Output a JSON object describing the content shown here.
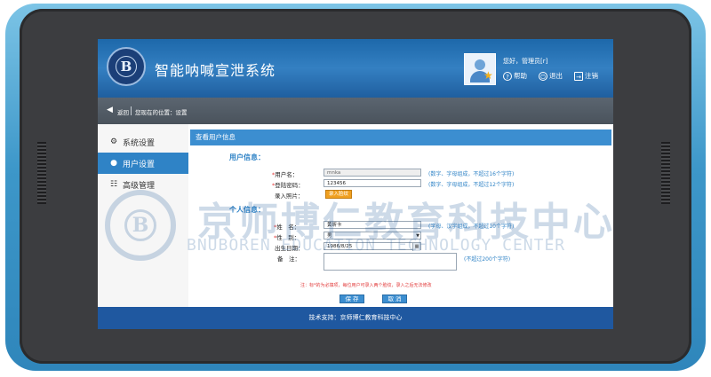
{
  "app": {
    "title": "智能呐喊宣泄系统"
  },
  "header": {
    "greeting": "您好，管理员[r]",
    "help_label": "帮助",
    "exit_label": "退出",
    "logout_label": "注销",
    "logo_text": "B"
  },
  "breadcrumb": {
    "back_label": "返回",
    "location": "您现在的位置：设置"
  },
  "sidebar": {
    "items": [
      {
        "label": "系统设置",
        "icon": "gear-icon",
        "active": false
      },
      {
        "label": "用户设置",
        "icon": "user-icon",
        "active": true
      },
      {
        "label": "高级管理",
        "icon": "sliders-icon",
        "active": false
      }
    ]
  },
  "panel": {
    "title": "查看用户信息"
  },
  "user_info": {
    "section_title": "用户信息：",
    "username_label": "用户名：",
    "username_value": "mnka",
    "username_hint": "(数字、字母组成，不超过16个字符)",
    "password_label": "登陆密码：",
    "password_value": "123456",
    "password_hint": "(数字、字母组成，不超过12个字符)",
    "avatar_label": "录入照片：",
    "avatar_button": "录入脸纹"
  },
  "personal_info": {
    "section_title": "个人信息：",
    "name_label": "姓　名：",
    "name_value": "黄昕卡",
    "name_hint": "(字母、汉字组成，不超过10个字符)",
    "gender_label": "性　别：",
    "gender_value": "男",
    "birth_label": "出生日期：",
    "birth_value": "1986/8/25",
    "note_label": "备　注：",
    "note_value": "",
    "note_hint": "(不超过200个字符)"
  },
  "notice": "注：标*的为必填项，每位用户可录入两个脸纹，录入之后无法修改",
  "actions": {
    "save": "保 存",
    "cancel": "取 消"
  },
  "footer": {
    "text": "技术支持：京师博仁教育科技中心"
  },
  "watermark": {
    "cn": "京师博仁教育科技中心",
    "en": "BNUBOREN EDUCATION TECHNOLOGY CENTER"
  },
  "colors": {
    "header": "#2f76b8",
    "accent": "#3c8ed0",
    "footer": "#1f58a0",
    "required": "#e23b3b",
    "orange_button": "#f0a020"
  }
}
